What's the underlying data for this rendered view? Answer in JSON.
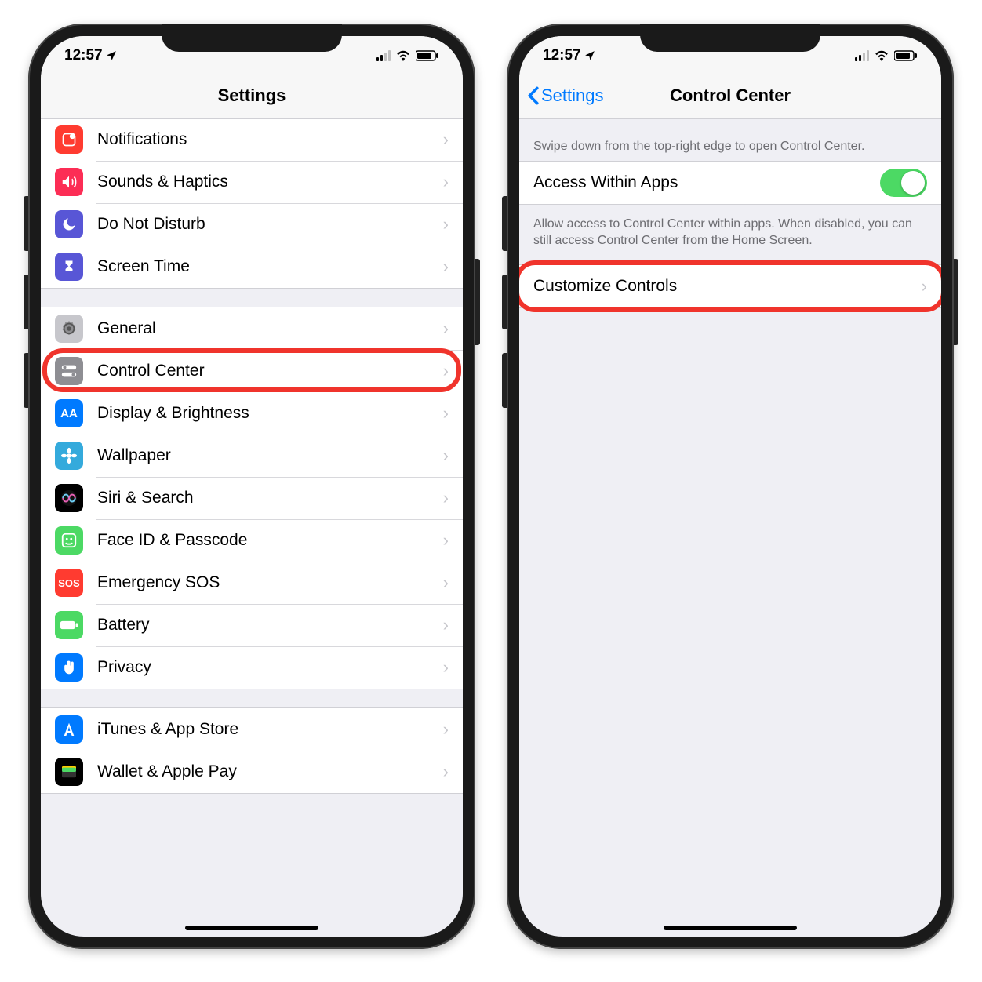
{
  "status": {
    "time": "12:57"
  },
  "left_screen": {
    "nav_title": "Settings",
    "group1": [
      {
        "label": "Notifications",
        "color": "ic-red",
        "icon_name": "notifications-icon",
        "glyph": "notif"
      },
      {
        "label": "Sounds & Haptics",
        "color": "ic-pink",
        "icon_name": "sounds-icon",
        "glyph": "sound"
      },
      {
        "label": "Do Not Disturb",
        "color": "ic-purple",
        "icon_name": "moon-icon",
        "glyph": "moon"
      },
      {
        "label": "Screen Time",
        "color": "ic-purple",
        "icon_name": "screentime-icon",
        "glyph": "hourglass"
      }
    ],
    "group2": [
      {
        "label": "General",
        "color": "ic-ltgrey",
        "icon_name": "gear-icon",
        "glyph": "gear"
      },
      {
        "label": "Control Center",
        "color": "ic-grey",
        "icon_name": "switches-icon",
        "glyph": "switches",
        "highlight": true
      },
      {
        "label": "Display & Brightness",
        "color": "ic-blue",
        "icon_name": "display-icon",
        "glyph": "AA"
      },
      {
        "label": "Wallpaper",
        "color": "ic-cyan",
        "icon_name": "wallpaper-icon",
        "glyph": "flower"
      },
      {
        "label": "Siri & Search",
        "color": "ic-black",
        "icon_name": "siri-icon",
        "glyph": "siri"
      },
      {
        "label": "Face ID & Passcode",
        "color": "ic-green",
        "icon_name": "faceid-icon",
        "glyph": "face"
      },
      {
        "label": "Emergency SOS",
        "color": "ic-red",
        "icon_name": "sos-icon",
        "glyph": "SOS"
      },
      {
        "label": "Battery",
        "color": "ic-green",
        "icon_name": "battery-icon",
        "glyph": "batt"
      },
      {
        "label": "Privacy",
        "color": "ic-priv",
        "icon_name": "privacy-icon",
        "glyph": "hand"
      }
    ],
    "group3": [
      {
        "label": "iTunes & App Store",
        "color": "ic-blue",
        "icon_name": "appstore-icon",
        "glyph": "A"
      },
      {
        "label": "Wallet & Apple Pay",
        "color": "ic-black",
        "icon_name": "wallet-icon",
        "glyph": "wallet"
      }
    ]
  },
  "right_screen": {
    "nav_back": "Settings",
    "nav_title": "Control Center",
    "header_note": "Swipe down from the top-right edge to open Control Center.",
    "access_row": "Access Within Apps",
    "access_footer": "Allow access to Control Center within apps. When disabled, you can still access Control Center from the Home Screen.",
    "customize_row": "Customize Controls"
  }
}
